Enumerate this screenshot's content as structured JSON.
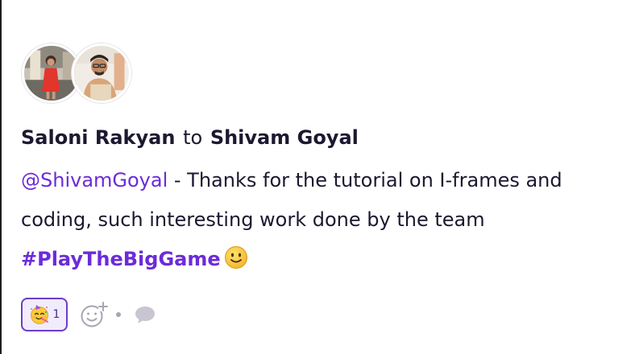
{
  "post": {
    "author": "Saloni Rakyan",
    "connector": "to",
    "recipient": "Shivam Goyal",
    "mention": "@ShivamGoyal",
    "body": " - Thanks for the tutorial on I-frames and coding, such interesting work done by the team ",
    "hashtag": "#PlayTheBigGame",
    "trailing_emoji": "slightly-smiling-face"
  },
  "avatars": [
    {
      "icon": "avatar-photo-saloni"
    },
    {
      "icon": "avatar-photo-shivam"
    }
  ],
  "reactions": {
    "items": [
      {
        "emoji": "partying-face",
        "count": "1"
      }
    ],
    "add_icon": "add-reaction-icon",
    "comment_icon": "comment-icon"
  },
  "colors": {
    "accent": "#6c2bd9",
    "text": "#1b1830",
    "pill_border": "#6c3ec9",
    "pill_bg": "#f1ecfb",
    "muted_icon": "#a8a5b3"
  }
}
